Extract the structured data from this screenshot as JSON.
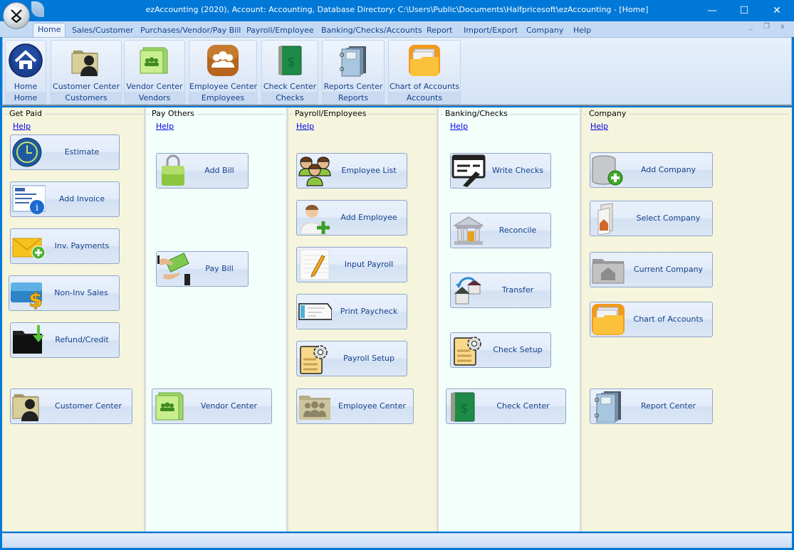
{
  "window": {
    "title": "ezAccounting (2020), Account: Accounting, Database Directory: C:\\Users\\Public\\Documents\\Halfpricesoft\\ezAccounting - [Home]",
    "controls": {
      "minimize": "—",
      "maximize": "☐",
      "close": "✕"
    },
    "mdi_controls": {
      "minimize": "_",
      "restore": "❐",
      "close": "x"
    }
  },
  "menu": {
    "tabs": [
      {
        "label": "Home",
        "active": true
      },
      {
        "label": "Sales/Customer"
      },
      {
        "label": "Purchases/Vendor/Pay Bill"
      },
      {
        "label": "Payroll/Employee"
      },
      {
        "label": "Banking/Checks/Accounts"
      },
      {
        "label": "Report"
      },
      {
        "label": "Import/Export"
      },
      {
        "label": "Company"
      },
      {
        "label": "Help"
      }
    ]
  },
  "ribbon": {
    "groups": [
      {
        "button": "Home",
        "group": "Home",
        "icon": "home-icon"
      },
      {
        "button": "Customer Center",
        "group": "Customers",
        "icon": "customer-folder-icon"
      },
      {
        "button": "Vendor Center",
        "group": "Vendors",
        "icon": "vendor-book-icon"
      },
      {
        "button": "Employee Center",
        "group": "Employees",
        "icon": "employees-icon"
      },
      {
        "button": "Check Center",
        "group": "Checks",
        "icon": "checkbook-icon"
      },
      {
        "button": "Reports Center",
        "group": "Reports",
        "icon": "reports-binder-icon"
      },
      {
        "button": "Chart of Accounts",
        "group": "Accounts",
        "icon": "accounts-folder-icon"
      }
    ]
  },
  "sections": [
    {
      "title": "Get Paid",
      "help": "Help",
      "buttons": [
        {
          "label": "Estimate",
          "icon": "clock-icon"
        },
        {
          "label": "Add Invoice",
          "icon": "invoice-info-icon"
        },
        {
          "label": "Inv. Payments",
          "icon": "envelope-add-icon"
        },
        {
          "label": "Non-Inv Sales",
          "icon": "credit-card-dollar-icon"
        },
        {
          "label": "Refund/Credit",
          "icon": "folder-download-icon"
        },
        {
          "label": "Customer Center",
          "icon": "customer-folder-icon"
        }
      ]
    },
    {
      "title": "Pay Others",
      "help": "Help",
      "buttons": [
        {
          "label": "Add Bill",
          "icon": "shopping-bag-icon"
        },
        {
          "label": "Pay Bill",
          "icon": "money-hands-icon"
        },
        {
          "label": "Vendor Center",
          "icon": "vendor-book-icon"
        }
      ]
    },
    {
      "title": "Payroll/Employees",
      "help": "Help",
      "buttons": [
        {
          "label": "Employee List",
          "icon": "employee-group-icon"
        },
        {
          "label": "Add Employee",
          "icon": "add-person-icon"
        },
        {
          "label": "Input Payroll",
          "icon": "notepad-pencil-icon"
        },
        {
          "label": "Print Paycheck",
          "icon": "paycheck-icon"
        },
        {
          "label": "Payroll Setup",
          "icon": "document-gear-icon"
        },
        {
          "label": "Employee Center",
          "icon": "employees-folder-icon"
        }
      ]
    },
    {
      "title": "Banking/Checks",
      "help": "Help",
      "buttons": [
        {
          "label": "Write Checks",
          "icon": "check-pen-icon"
        },
        {
          "label": "Reconcile",
          "icon": "bank-icon"
        },
        {
          "label": "Transfer",
          "icon": "transfer-icon"
        },
        {
          "label": "Check Setup",
          "icon": "document-gear-icon"
        },
        {
          "label": "Check Center",
          "icon": "checkbook-icon"
        }
      ]
    },
    {
      "title": "Company",
      "help": "Help",
      "buttons": [
        {
          "label": "Add Company",
          "icon": "database-add-icon"
        },
        {
          "label": "Select Company",
          "icon": "open-folder-icon"
        },
        {
          "label": "Current Company",
          "icon": "home-folder-icon"
        },
        {
          "label": "Chart of Accounts",
          "icon": "accounts-folder-icon"
        },
        {
          "label": "Report Center",
          "icon": "reports-binder-icon"
        }
      ]
    }
  ],
  "colors": {
    "titlebar": "#0078d7",
    "ribbon_text": "#15428b",
    "link": "#0000ee",
    "cream_panel": "#f5f4dc",
    "mint_panel": "#f3fffa"
  }
}
